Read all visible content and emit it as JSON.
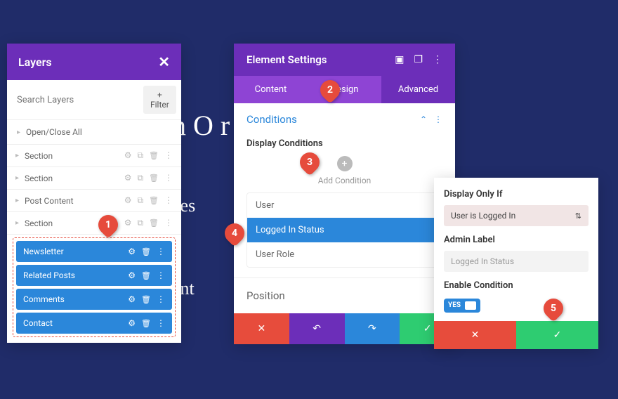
{
  "background": {
    "text1": "n O                          r",
    "text2": "ces",
    "text3": "ent"
  },
  "layers": {
    "title": "Layers",
    "search_placeholder": "Search Layers",
    "filter_label": "+ Filter",
    "open_close": "Open/Close All",
    "rows": [
      {
        "label": "Section"
      },
      {
        "label": "Section"
      },
      {
        "label": "Post Content"
      },
      {
        "label": "Section"
      }
    ],
    "highlighted": [
      {
        "label": "Newsletter"
      },
      {
        "label": "Related Posts"
      },
      {
        "label": "Comments"
      },
      {
        "label": "Contact"
      }
    ]
  },
  "settings": {
    "title": "Element Settings",
    "tabs": {
      "content": "Content",
      "design": "Design",
      "advanced": "Advanced"
    },
    "conditions": {
      "title": "Conditions",
      "display_label": "Display Conditions",
      "add_label": "Add Condition",
      "items": [
        {
          "label": "User",
          "selected": false
        },
        {
          "label": "Logged In Status",
          "selected": true
        },
        {
          "label": "User Role",
          "selected": false
        }
      ]
    },
    "position": {
      "title": "Position"
    }
  },
  "cond_panel": {
    "display_only_label": "Display Only If",
    "display_only_value": "User is Logged In",
    "admin_label_label": "Admin Label",
    "admin_label_value": "Logged In Status",
    "enable_label": "Enable Condition",
    "toggle_value": "YES"
  },
  "markers": {
    "m1": "1",
    "m2": "2",
    "m3": "3",
    "m4": "4",
    "m5": "5"
  }
}
